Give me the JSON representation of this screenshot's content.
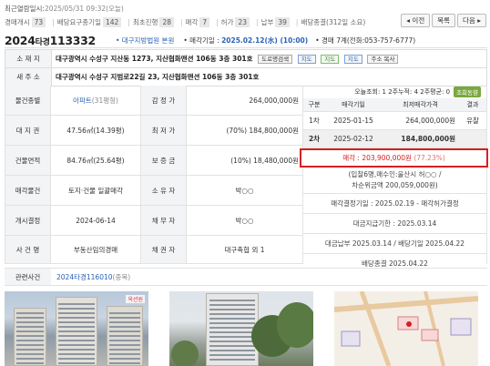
{
  "update": {
    "label": "최근열람일시:",
    "value": "2025/05/31 09:32(오늘)"
  },
  "stats": [
    {
      "label": "경매개시",
      "count": "73"
    },
    {
      "label": "배당요구종기일",
      "count": "142"
    },
    {
      "label": "최초진행",
      "count": "28"
    },
    {
      "label": "매각",
      "count": "7"
    },
    {
      "label": "허가",
      "count": "23"
    },
    {
      "label": "납부",
      "count": "39"
    },
    {
      "label": "배당종결(312일 소요)",
      "count": ""
    }
  ],
  "nav": {
    "prev": "◂ 이전",
    "list": "목록",
    "next": "다음 ▸"
  },
  "case": {
    "year": "2024",
    "type": "타경",
    "no": "113332",
    "court": "• 대구지방법원 본원",
    "sale_label": "• 매각기일 : ",
    "sale_value": "2025.02.12(水) (10:00)",
    "contact": "• 경매 7계(전화:053-757-6777)"
  },
  "info": {
    "loc_label": "소 재 지",
    "loc_value": "대구광역시 수성구 지산동 1273, 지산협화맨션 106동 3층 301호",
    "btn_road": "도로명검색",
    "btn_map1": "지도",
    "btn_map2": "지도",
    "btn_map3": "지도",
    "btn_addr": "주소 복사",
    "new_label": "새 주 소",
    "new_value": "대구광역시 수성구 지범로22길 23, 지산협화맨션 106동 3층 301호"
  },
  "grid": {
    "rows": [
      {
        "l1": "물건종별",
        "v1": "아파트",
        "v1b": "(31평형)",
        "l2": "감 정 가",
        "v2": "264,000,000원"
      },
      {
        "l1": "대 지 권",
        "v1": "47.56㎡(14.39평)",
        "v1b": "",
        "l2": "최 저 가",
        "v2": "(70%) 184,800,000원"
      },
      {
        "l1": "건물면적",
        "v1": "84.76㎡(25.64평)",
        "v1b": "",
        "l2": "보 증 금",
        "v2": "(10%) 18,480,000원"
      },
      {
        "l1": "매각물건",
        "v1": "토지·건물 일괄매각",
        "v1b": "",
        "l2": "소 유 자",
        "v2": "박○○"
      },
      {
        "l1": "개시결정",
        "v1": "2024-06-14",
        "v1b": "",
        "l2": "채 무 자",
        "v2": "박○○"
      },
      {
        "l1": "사 건 명",
        "v1": "부동산임의경매",
        "v1b": "",
        "l2": "채 권 자",
        "v2": "대구축협 외 1"
      }
    ]
  },
  "history": {
    "summary": "오늘조회: 1  2주누적: 4  2주평균: 0",
    "badge": "조회동향",
    "head": [
      "구분",
      "매각기일",
      "최저매각가격",
      "결과"
    ],
    "rows": [
      {
        "c1": "1차",
        "c2": "2025-01-15",
        "c3": "264,000,000원",
        "c4": "유찰"
      },
      {
        "c1": "2차",
        "c2": "2025-02-12",
        "c3": "184,800,000원",
        "c4": ""
      }
    ],
    "sold": "매각 : 203,900,000원",
    "sold_pct": "(77.23%)",
    "lines": [
      "(입찰6명,매수인:울산시 허○○ /",
      "차순위금액 200,059,000원)",
      "매각결정기일 : 2025.02.19 - 매각허가결정",
      "대금지급기한 : 2025.03.14",
      "대금납부 2025.03.14 / 배당기일 2025.04.22",
      "배당종결 2025.04.22"
    ]
  },
  "related": {
    "label": "관련사건",
    "value": "2024타경116010",
    "note": "(중복)"
  },
  "photos": {
    "watermark": "옥션원"
  }
}
